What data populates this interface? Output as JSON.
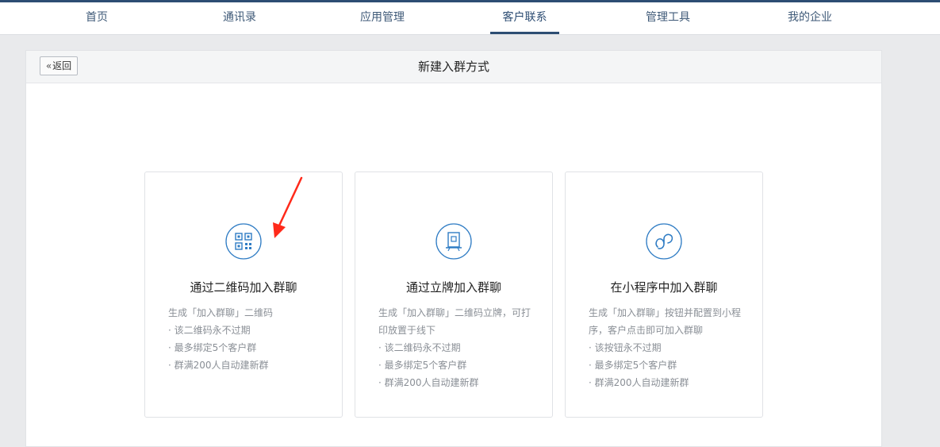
{
  "nav": {
    "items": [
      {
        "label": "首页"
      },
      {
        "label": "通讯录"
      },
      {
        "label": "应用管理"
      },
      {
        "label": "客户联系"
      },
      {
        "label": "管理工具"
      },
      {
        "label": "我的企业"
      }
    ],
    "active": "客户联系"
  },
  "panel": {
    "back_label": "返回",
    "title": "新建入群方式"
  },
  "cards": [
    {
      "icon": "qrcode-icon",
      "title": "通过二维码加入群聊",
      "lines": [
        "生成「加入群聊」二维码",
        "· 该二维码永不过期",
        "· 最多绑定5个客户群",
        "· 群满200人自动建新群"
      ]
    },
    {
      "icon": "standee-icon",
      "title": "通过立牌加入群聊",
      "lines": [
        "生成「加入群聊」二维码立牌，可打印放置于线下",
        "· 该二维码永不过期",
        "· 最多绑定5个客户群",
        "· 群满200人自动建新群"
      ]
    },
    {
      "icon": "mini-program-icon",
      "title": "在小程序中加入群聊",
      "lines": [
        "生成「加入群聊」按钮并配置到小程序，客户点击即可加入群聊",
        "· 该按钮永不过期",
        "· 最多绑定5个客户群",
        "· 群满200人自动建新群"
      ]
    }
  ],
  "colors": {
    "accent": "#2d4d73",
    "icon_blue": "#2f7cc4",
    "annotation_arrow": "#ff2a1a"
  }
}
